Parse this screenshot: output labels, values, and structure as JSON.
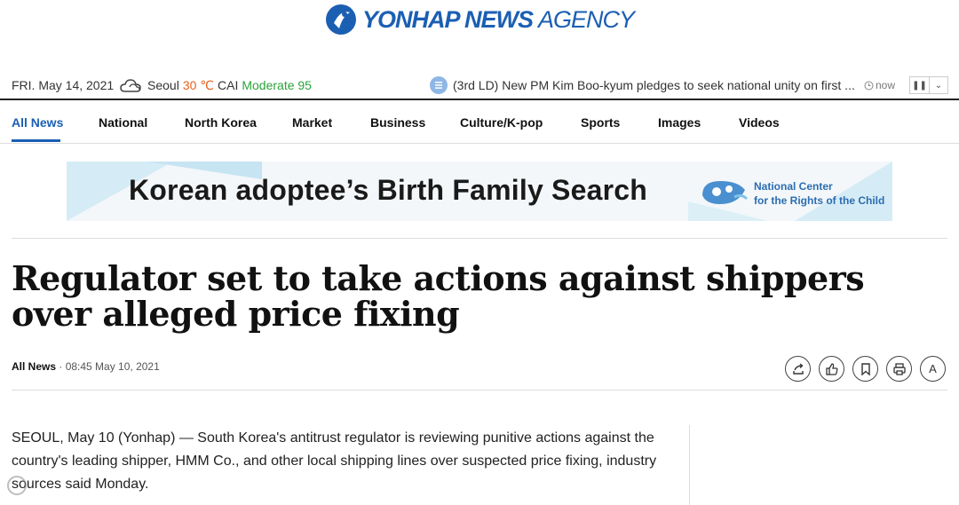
{
  "logo": {
    "bold": "YONHAP NEWS",
    "light": "AGENCY"
  },
  "infobar": {
    "date": "FRI. May 14, 2021",
    "city": "Seoul",
    "temperature": "30 ℃",
    "cai_label": "CAI",
    "cai_value": "Moderate 95",
    "ticker": "(3rd LD) New PM Kim Boo-kyum pledges to seek national unity on first ...",
    "now": "now",
    "pause_icon": "pause-icon",
    "dropdown_icon": "chevron-down-icon"
  },
  "nav": {
    "items": [
      {
        "label": "All News"
      },
      {
        "label": "National"
      },
      {
        "label": "North Korea"
      },
      {
        "label": "Market"
      },
      {
        "label": "Business"
      },
      {
        "label": "Culture/K-pop"
      },
      {
        "label": "Sports"
      },
      {
        "label": "Images"
      },
      {
        "label": "Videos"
      }
    ],
    "active_color": "#1b5fb3"
  },
  "banner": {
    "title": "Korean adoptee’s Birth Family Search",
    "org_line1": "National Center",
    "org_line2": "for the Rights of the Child"
  },
  "article": {
    "title": "Regulator set to take actions against shippers over alleged price fixing",
    "category": "All News",
    "timestamp": "· 08:45 May 10, 2021",
    "body": "SEOUL, May 10 (Yonhap) — South Korea's antitrust regulator is reviewing punitive actions against the country's leading shipper, HMM Co., and other local shipping lines over suspected price fixing, industry sources said Monday."
  },
  "tools": [
    "share-icon",
    "like-icon",
    "bookmark-icon",
    "print-icon",
    "font-size-icon"
  ],
  "tool_font_label": "A",
  "colors": {
    "brand": "#1b5fb3",
    "temperature": "#e8601c",
    "cai": "#2aa33a"
  }
}
